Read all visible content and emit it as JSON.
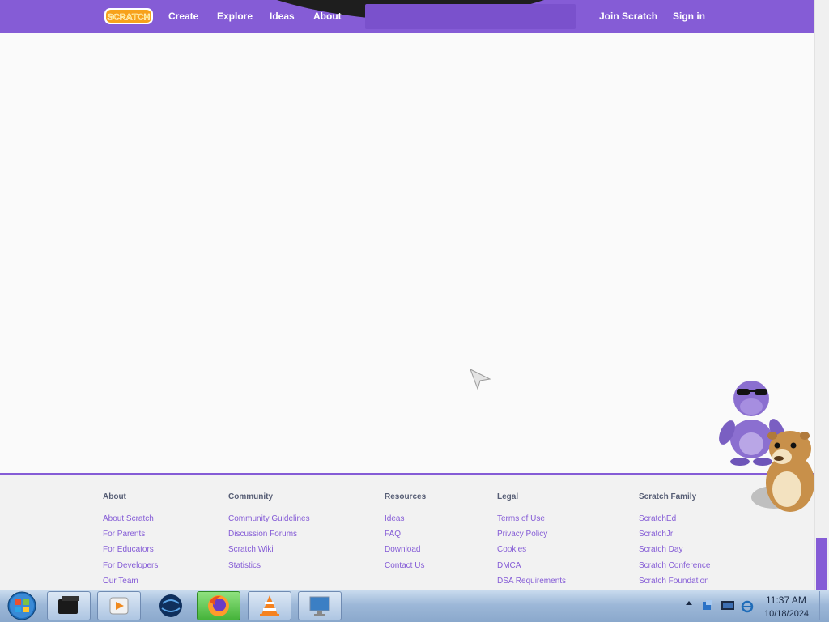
{
  "navbar": {
    "logo_text": "SCRATCH",
    "links": [
      "Create",
      "Explore",
      "Ideas",
      "About"
    ],
    "join": "Join Scratch",
    "signin": "Sign in",
    "color": "#855cd6"
  },
  "footer": {
    "columns": [
      {
        "heading": "About",
        "links": [
          "About Scratch",
          "For Parents",
          "For Educators",
          "For Developers",
          "Our Team"
        ]
      },
      {
        "heading": "Community",
        "links": [
          "Community Guidelines",
          "Discussion Forums",
          "Scratch Wiki",
          "Statistics"
        ]
      },
      {
        "heading": "Resources",
        "links": [
          "Ideas",
          "FAQ",
          "Download",
          "Contact Us"
        ]
      },
      {
        "heading": "Legal",
        "links": [
          "Terms of Use",
          "Privacy Policy",
          "Cookies",
          "DMCA",
          "DSA Requirements"
        ]
      },
      {
        "heading": "Scratch Family",
        "links": [
          "ScratchEd",
          "ScratchJr",
          "Scratch Day",
          "Scratch Conference",
          "Scratch Foundation"
        ]
      }
    ]
  },
  "taskbar": {
    "apps": [
      "start-orb",
      "device-manager",
      "media-player",
      "globe-app",
      "firefox",
      "vlc",
      "remote-desktop"
    ],
    "active_app": "firefox",
    "clock": {
      "time": "11:37 AM",
      "date": "10/18/2024"
    },
    "tray_icons": [
      "show-hidden-icons",
      "network-icon",
      "display-icon",
      "ie-icon"
    ]
  }
}
